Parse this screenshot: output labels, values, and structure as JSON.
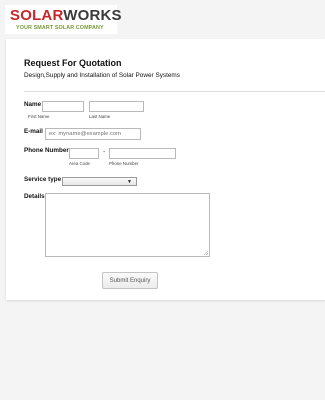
{
  "brand": {
    "name_part1": "SOLAR",
    "name_part2": "WORKS",
    "tagline": "YOUR SMART SOLAR COMPANY"
  },
  "form": {
    "title": "Request For Quotation",
    "subtitle": "Design,Supply and Installation of Solar Power Systems",
    "fields": {
      "name": {
        "label": "Name",
        "first_sublabel": "First Name",
        "last_sublabel": "Last Name",
        "first_value": "",
        "last_value": ""
      },
      "email": {
        "label": "E-mail",
        "placeholder": "ex: myname@example.com",
        "value": ""
      },
      "phone": {
        "label": "Phone Number",
        "separator": "-",
        "area_sublabel": "Area Code",
        "number_sublabel": "Phone Number",
        "area_value": "",
        "number_value": ""
      },
      "service": {
        "label": "Service type",
        "selected": "",
        "arrow": "▼"
      },
      "details": {
        "label": "Details",
        "value": ""
      }
    },
    "submit_label": "Submit Enquiry"
  },
  "colors": {
    "brand_red": "#c8262a",
    "brand_dark": "#3a3a3a",
    "tagline_green": "#7a9a3a",
    "page_background": "#f4f4f4"
  }
}
